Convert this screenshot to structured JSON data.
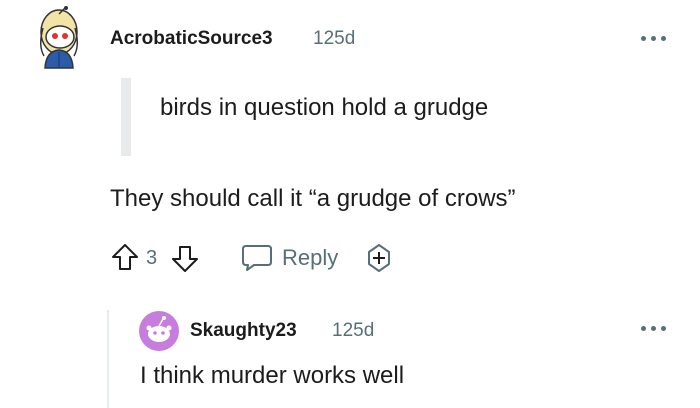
{
  "comment": {
    "author": "AcrobaticSource3",
    "age": "125d",
    "quote": "birds in question hold a grudge",
    "body": "They should call it “a grudge of crows”",
    "votes": "3",
    "reply_label": "Reply"
  },
  "reply": {
    "author": "Skaughty23",
    "age": "125d",
    "body": "I think murder works well"
  },
  "colors": {
    "text": "#1c1c1c",
    "muted": "#576f76",
    "quote_bar": "#e8eaeb",
    "avatar_purple": "#c77dde"
  },
  "icons": [
    "more-options-icon",
    "upvote-icon",
    "downvote-icon",
    "reply-icon",
    "award-icon"
  ]
}
